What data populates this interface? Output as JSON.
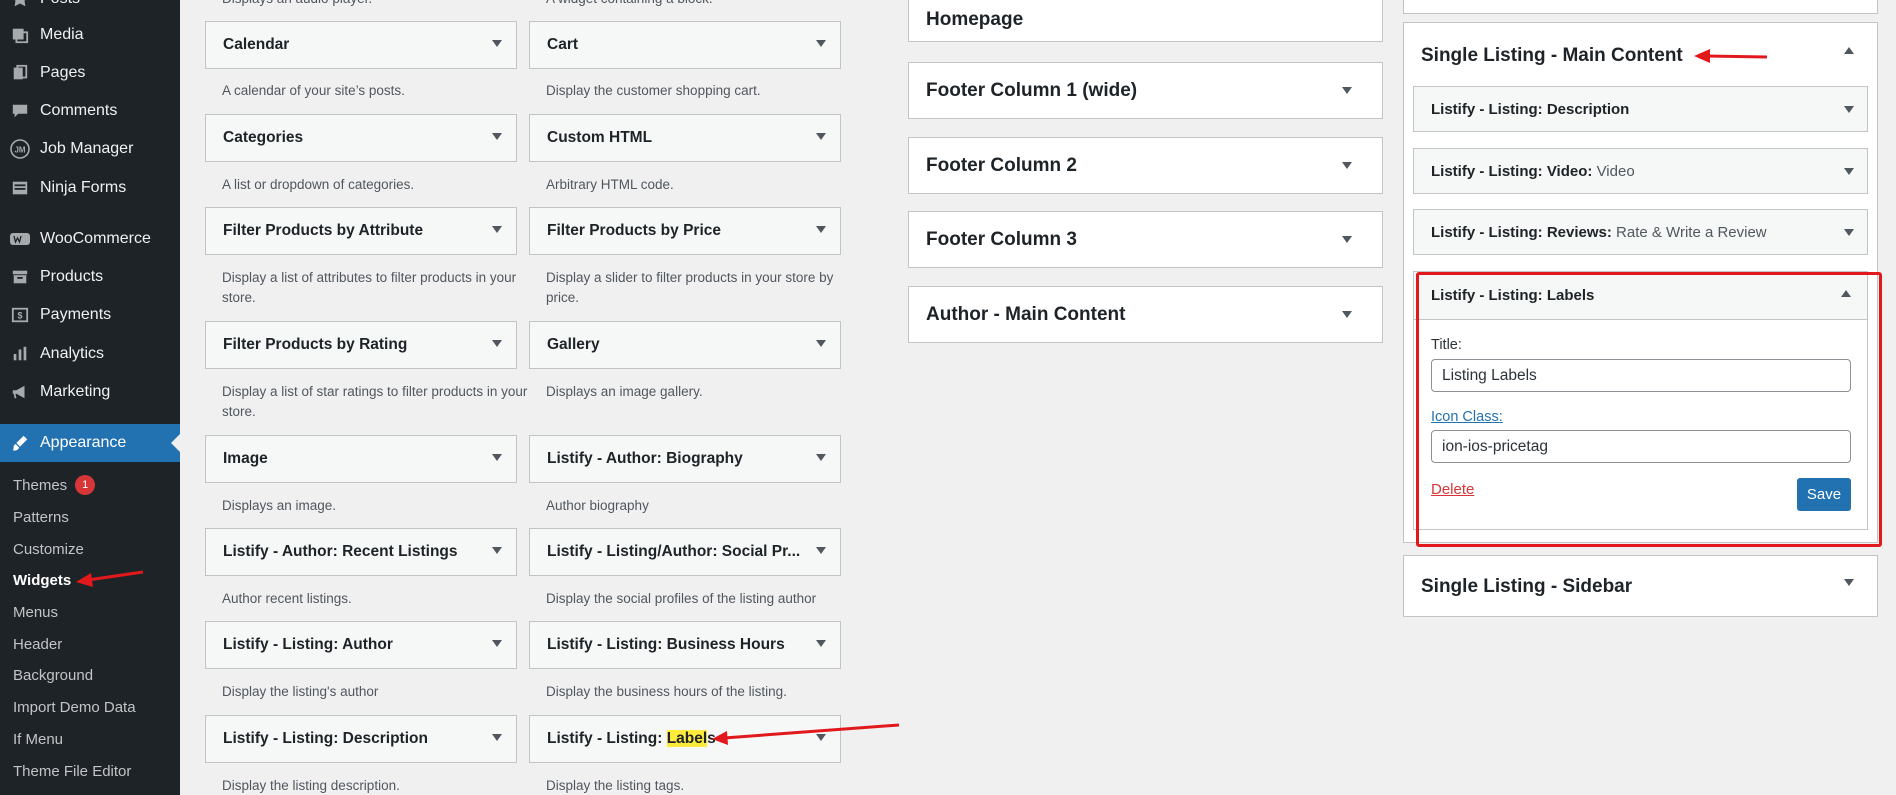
{
  "sidebar": {
    "items": [
      {
        "label": "Posts",
        "icon": "pin-icon"
      },
      {
        "label": "Media",
        "icon": "media-icon"
      },
      {
        "label": "Pages",
        "icon": "pages-icon"
      },
      {
        "label": "Comments",
        "icon": "comments-icon"
      },
      {
        "label": "Job Manager",
        "icon": "jm-icon"
      },
      {
        "label": "Ninja Forms",
        "icon": "forms-icon"
      },
      {
        "label": "WooCommerce",
        "icon": "woo-icon"
      },
      {
        "label": "Products",
        "icon": "archive-icon"
      },
      {
        "label": "Payments",
        "icon": "payments-icon"
      },
      {
        "label": "Analytics",
        "icon": "chart-icon"
      },
      {
        "label": "Marketing",
        "icon": "megaphone-icon"
      },
      {
        "label": "Appearance",
        "icon": "brush-icon"
      }
    ],
    "submenu": [
      {
        "label": "Themes",
        "badge": "1"
      },
      {
        "label": "Patterns"
      },
      {
        "label": "Customize"
      },
      {
        "label": "Widgets"
      },
      {
        "label": "Menus"
      },
      {
        "label": "Header"
      },
      {
        "label": "Background"
      },
      {
        "label": "Import Demo Data"
      },
      {
        "label": "If Menu"
      },
      {
        "label": "Theme File Editor"
      }
    ]
  },
  "available_widgets": {
    "top_desc_left": "Displays an audio player.",
    "top_desc_right": "A widget containing a block.",
    "rows": [
      {
        "left": {
          "title": "Calendar",
          "desc": "A calendar of your site’s posts."
        },
        "right": {
          "title": "Cart",
          "desc": "Display the customer shopping cart."
        }
      },
      {
        "left": {
          "title": "Categories",
          "desc": "A list or dropdown of categories."
        },
        "right": {
          "title": "Custom HTML",
          "desc": "Arbitrary HTML code."
        }
      },
      {
        "left": {
          "title": "Filter Products by Attribute",
          "desc": "Display a list of attributes to filter products in your store."
        },
        "right": {
          "title": "Filter Products by Price",
          "desc": "Display a slider to filter products in your store by price."
        }
      },
      {
        "left": {
          "title": "Filter Products by Rating",
          "desc": "Display a list of star ratings to filter products in your store."
        },
        "right": {
          "title": "Gallery",
          "desc": "Displays an image gallery."
        }
      },
      {
        "left": {
          "title": "Image",
          "desc": "Displays an image."
        },
        "right": {
          "title": "Listify - Author: Biography",
          "desc": "Author biography"
        }
      },
      {
        "left": {
          "title": "Listify - Author: Recent Listings",
          "desc": "Author recent listings."
        },
        "right": {
          "title": "Listify - Listing/Author: Social Pr...",
          "desc": "Display the social profiles of the listing author"
        }
      },
      {
        "left": {
          "title": "Listify - Listing: Author",
          "desc": "Display the listing's author"
        },
        "right": {
          "title": "Listify - Listing: Business Hours",
          "desc": "Display the business hours of the listing."
        }
      },
      {
        "left": {
          "title": "Listify - Listing: Description",
          "desc": "Display the listing description."
        },
        "right": {
          "title_prefix": "Listify - Listing: ",
          "title_highlight": "Label",
          "title_suffix": "s",
          "desc": "Display the listing tags."
        }
      }
    ]
  },
  "areas": [
    {
      "title": "Homepage"
    },
    {
      "title": "Footer Column 1 (wide)"
    },
    {
      "title": "Footer Column 2"
    },
    {
      "title": "Footer Column 3"
    },
    {
      "title": "Author - Main Content"
    }
  ],
  "main_content": {
    "title": "Single Listing - Main Content",
    "widgets": [
      {
        "title": "Listify - Listing: Description",
        "sub": ""
      },
      {
        "title": "Listify - Listing: Video: ",
        "sub": "Video"
      },
      {
        "title": "Listify - Listing: Reviews: ",
        "sub": "Rate & Write a Review"
      }
    ],
    "expanded": {
      "title": "Listify - Listing: Labels",
      "title_field_label": "Title:",
      "title_field_value": "Listing Labels",
      "icon_field_label": "Icon Class:",
      "icon_field_value": "ion-ios-pricetag",
      "delete_label": "Delete",
      "save_label": "Save"
    }
  },
  "sidebar_area": {
    "title": "Single Listing - Sidebar"
  },
  "colors": {
    "accent": "#2271b1",
    "annotation": "#e2191c",
    "highlight": "#ffeb3b"
  }
}
